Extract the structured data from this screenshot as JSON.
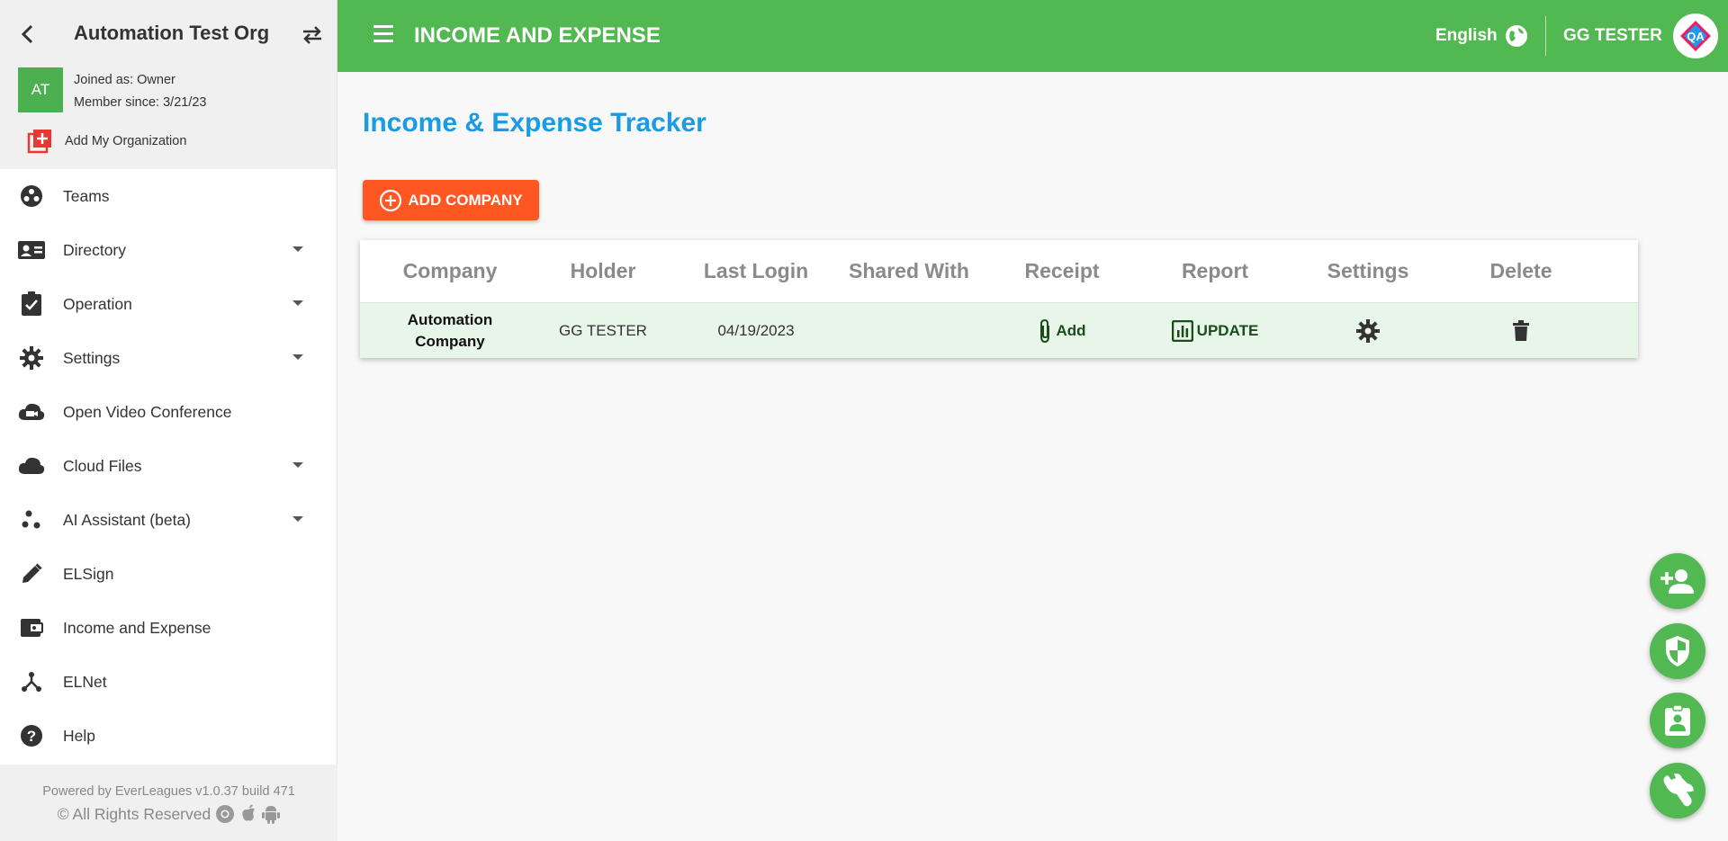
{
  "sidebar": {
    "org_name": "Automation Test Org",
    "avatar_initials": "AT",
    "joined_as": "Joined as: Owner",
    "member_since": "Member since: 3/21/23",
    "add_org_label": "Add My Organization",
    "items": [
      {
        "label": "Teams",
        "icon": "teams-icon"
      },
      {
        "label": "Directory",
        "icon": "contact-card-icon"
      },
      {
        "label": "Operation",
        "icon": "clipboard-check-icon"
      },
      {
        "label": "Settings",
        "icon": "gear-icon"
      },
      {
        "label": "Open Video Conference",
        "icon": "video-cloud-icon"
      },
      {
        "label": "Cloud Files",
        "icon": "cloud-icon"
      },
      {
        "label": "AI Assistant (beta)",
        "icon": "dots-icon"
      },
      {
        "label": "ELSign",
        "icon": "pencil-icon"
      },
      {
        "label": "Income and Expense",
        "icon": "wallet-icon"
      },
      {
        "label": "ELNet",
        "icon": "network-icon"
      },
      {
        "label": "Help",
        "icon": "help-icon"
      }
    ],
    "footer_powered": "Powered by EverLeagues v1.0.37 build 471",
    "footer_rights": "© All Rights Reserved"
  },
  "header": {
    "title": "INCOME AND EXPENSE",
    "language": "English",
    "user_name": "GG TESTER",
    "avatar_text": "QA"
  },
  "main": {
    "heading": "Income & Expense Tracker",
    "add_company_label": "ADD COMPANY",
    "table": {
      "columns": [
        "Company",
        "Holder",
        "Last Login",
        "Shared With",
        "Receipt",
        "Report",
        "Settings",
        "Delete"
      ],
      "rows": [
        {
          "company_line1": "Automation",
          "company_line2": "Company",
          "holder": "GG TESTER",
          "last_login": "04/19/2023",
          "shared_with": "",
          "receipt_label": "Add",
          "report_label": "UPDATE"
        }
      ]
    }
  },
  "colors": {
    "header_green": "#52b852",
    "heading_blue": "#1a9be6",
    "button_orange": "#ff5722",
    "row_highlight": "#e8f5e9"
  }
}
